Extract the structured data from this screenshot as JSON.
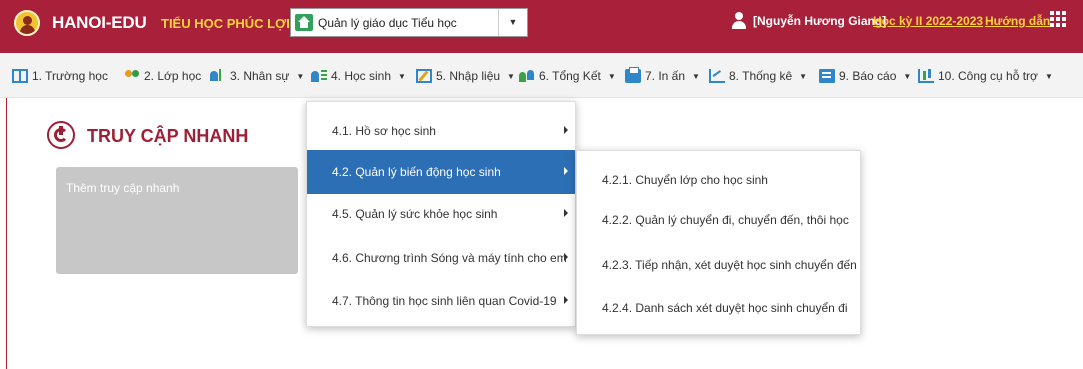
{
  "header": {
    "brand": "HANOI-EDU",
    "school": "TIỂU HỌC PHÚC LỢI",
    "module_select": "Quản lý giáo dục Tiểu học",
    "username": "[Nguyễn Hương Giang]",
    "semester": "Học kỳ II 2022-2023",
    "help": "Hướng dẫn"
  },
  "nav": [
    {
      "label": "1. Trường học",
      "icon": "school-grid-icon",
      "caret": false
    },
    {
      "label": "2. Lớp học",
      "icon": "class-people-icon",
      "caret": false
    },
    {
      "label": "3. Nhân sự",
      "icon": "staff-icon",
      "caret": true
    },
    {
      "label": "4. Học sinh",
      "icon": "student-icon",
      "caret": true
    },
    {
      "label": "5. Nhập liệu",
      "icon": "edit-icon",
      "caret": true
    },
    {
      "label": "6. Tổng Kết",
      "icon": "summary-icon",
      "caret": true
    },
    {
      "label": "7. In ấn",
      "icon": "print-icon",
      "caret": true
    },
    {
      "label": "8. Thống kê",
      "icon": "statistics-icon",
      "caret": true
    },
    {
      "label": "9. Báo cáo",
      "icon": "report-icon",
      "caret": true
    },
    {
      "label": "10. Công cụ hỗ trợ",
      "icon": "tools-icon",
      "caret": true
    }
  ],
  "quick_access": {
    "title": "TRUY CẬP NHANH",
    "add_label": "Thêm truy cập nhanh"
  },
  "student_menu": [
    {
      "label": "4.1. Hồ sơ học sinh"
    },
    {
      "label": "4.2. Quản lý biến động học sinh",
      "active": true
    },
    {
      "label": "4.5. Quản lý sức khỏe học sinh"
    },
    {
      "label": "4.6. Chương trình Sóng và máy tính cho em"
    },
    {
      "label": "4.7. Thông tin học sinh liên quan Covid-19"
    }
  ],
  "movement_submenu": [
    {
      "label": "4.2.1. Chuyển lớp cho học sinh"
    },
    {
      "label": "4.2.2. Quản lý chuyển đi, chuyển đến, thôi học"
    },
    {
      "label": "4.2.3. Tiếp nhận, xét duyệt học sinh chuyển đến"
    },
    {
      "label": "4.2.4. Danh sách xét duyệt học sinh chuyển đi"
    }
  ],
  "colors": {
    "header_bg": "#a8203a",
    "accent_yellow": "#ffd33a",
    "active_menu": "#2d6fb4"
  }
}
